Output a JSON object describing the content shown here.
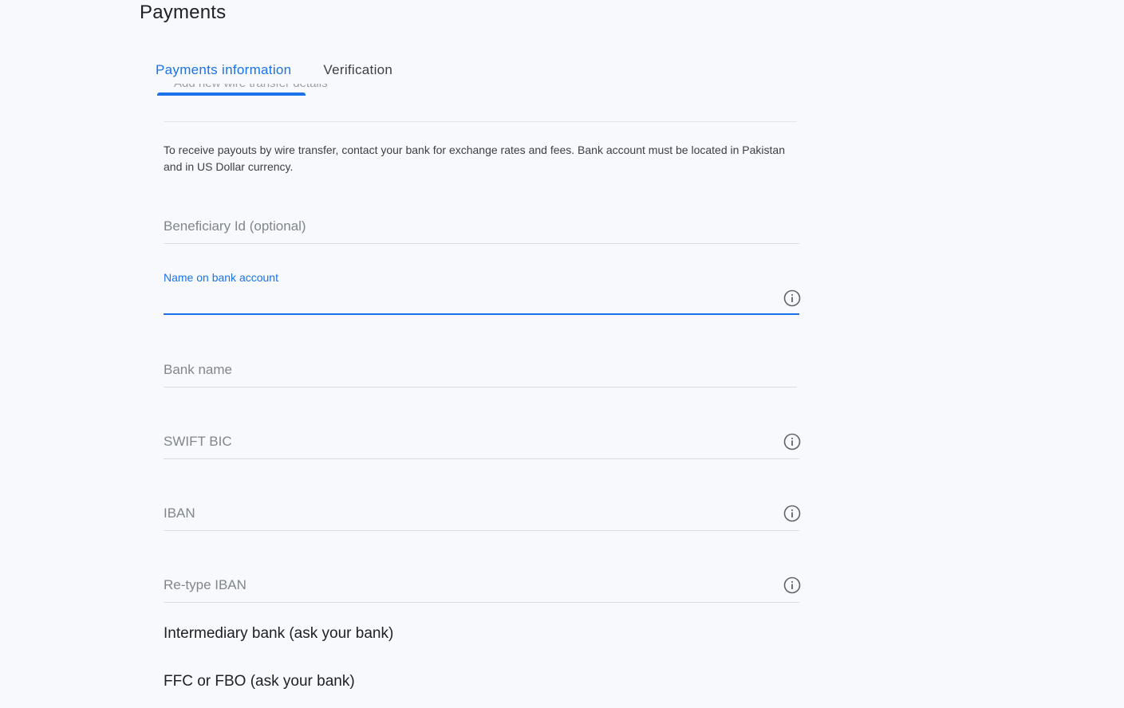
{
  "page": {
    "title": "Payments"
  },
  "tabs": [
    {
      "label": "Payments information",
      "active": true
    },
    {
      "label": "Verification",
      "active": false
    }
  ],
  "partial_text": "Add new wire transfer details",
  "notice": "To receive payouts by wire transfer, contact your bank for exchange rates and fees. Bank account must be located in Pakistan and in US Dollar currency.",
  "form": {
    "beneficiary_id": {
      "placeholder": "Beneficiary Id (optional)"
    },
    "name_on_account": {
      "label": "Name on bank account",
      "value": "",
      "info_icon": "info-icon"
    },
    "bank_name": {
      "placeholder": "Bank name"
    },
    "swift_bic": {
      "placeholder": "SWIFT BIC",
      "info_icon": "info-icon"
    },
    "iban": {
      "placeholder": "IBAN",
      "info_icon": "info-icon"
    },
    "retype_iban": {
      "placeholder": "Re-type IBAN",
      "info_icon": "info-icon"
    },
    "intermediary_bank": {
      "label": "Intermediary bank (ask your bank)"
    },
    "ffc_fbo": {
      "label": "FFC or FBO (ask your bank)"
    }
  },
  "colors": {
    "accent": "#1a73e8",
    "background": "#f8f9fd",
    "text": "#3c4043",
    "placeholder": "#80868b"
  }
}
